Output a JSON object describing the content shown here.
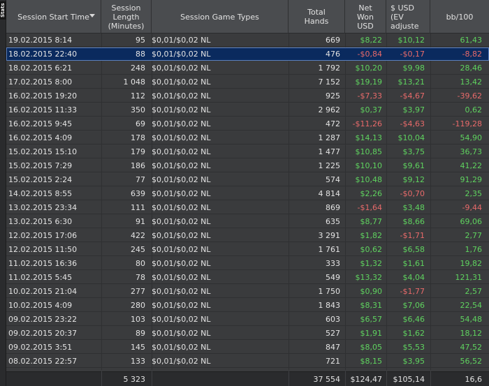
{
  "side_tab": {
    "label": "Stats"
  },
  "columns": {
    "start_time": "Session Start Time",
    "length": "Session Length (Minutes)",
    "game_types": "Session Game Types",
    "hands": "Total Hands",
    "net_won": "Net Won USD",
    "ev": "$ USD (EV adjuste",
    "bb100": "bb/100"
  },
  "colors": {
    "positive": "#5fd35f",
    "negative": "#e86a6a",
    "selected_row": "#0a2a5e"
  },
  "rows": [
    {
      "date": "19.02.2015 8:14",
      "len": "95",
      "type": "$0,01/$0,02 NL",
      "hands": "669",
      "net": "$8,22",
      "ev": "$10,12",
      "bb": "61,43",
      "net_s": "pos",
      "ev_s": "pos",
      "bb_s": "pos"
    },
    {
      "date": "18.02.2015 22:40",
      "len": "88",
      "type": "$0,01/$0,02 NL",
      "hands": "476",
      "net": "-$0,84",
      "ev": "-$0,17",
      "bb": "-8,82",
      "net_s": "neg",
      "ev_s": "neg",
      "bb_s": "neg",
      "selected": true
    },
    {
      "date": "18.02.2015 6:21",
      "len": "248",
      "type": "$0,01/$0,02 NL",
      "hands": "1 792",
      "net": "$10,20",
      "ev": "$9,98",
      "bb": "28,46",
      "net_s": "pos",
      "ev_s": "pos",
      "bb_s": "pos"
    },
    {
      "date": "17.02.2015 8:00",
      "len": "1 048",
      "type": "$0,01/$0,02 NL",
      "hands": "7 152",
      "net": "$19,19",
      "ev": "$13,21",
      "bb": "13,42",
      "net_s": "pos",
      "ev_s": "pos",
      "bb_s": "pos"
    },
    {
      "date": "16.02.2015 19:20",
      "len": "112",
      "type": "$0,01/$0,02 NL",
      "hands": "925",
      "net": "-$7,33",
      "ev": "-$4,67",
      "bb": "-39,62",
      "net_s": "neg",
      "ev_s": "neg",
      "bb_s": "neg"
    },
    {
      "date": "16.02.2015 11:33",
      "len": "350",
      "type": "$0,01/$0,02 NL",
      "hands": "2 962",
      "net": "$0,37",
      "ev": "$3,97",
      "bb": "0,62",
      "net_s": "pos",
      "ev_s": "pos",
      "bb_s": "pos"
    },
    {
      "date": "16.02.2015 9:45",
      "len": "69",
      "type": "$0,01/$0,02 NL",
      "hands": "472",
      "net": "-$11,26",
      "ev": "-$4,63",
      "bb": "-119,28",
      "net_s": "neg",
      "ev_s": "neg",
      "bb_s": "neg"
    },
    {
      "date": "16.02.2015 4:09",
      "len": "178",
      "type": "$0,01/$0,02 NL",
      "hands": "1 287",
      "net": "$14,13",
      "ev": "$10,04",
      "bb": "54,90",
      "net_s": "pos",
      "ev_s": "pos",
      "bb_s": "pos"
    },
    {
      "date": "15.02.2015 15:10",
      "len": "179",
      "type": "$0,01/$0,02 NL",
      "hands": "1 477",
      "net": "$10,85",
      "ev": "$3,75",
      "bb": "36,73",
      "net_s": "pos",
      "ev_s": "pos",
      "bb_s": "pos"
    },
    {
      "date": "15.02.2015 7:29",
      "len": "186",
      "type": "$0,01/$0,02 NL",
      "hands": "1 225",
      "net": "$10,10",
      "ev": "$9,61",
      "bb": "41,22",
      "net_s": "pos",
      "ev_s": "pos",
      "bb_s": "pos"
    },
    {
      "date": "15.02.2015 2:24",
      "len": "77",
      "type": "$0,01/$0,02 NL",
      "hands": "574",
      "net": "$10,48",
      "ev": "$9,12",
      "bb": "91,29",
      "net_s": "pos",
      "ev_s": "pos",
      "bb_s": "pos"
    },
    {
      "date": "14.02.2015 8:55",
      "len": "639",
      "type": "$0,01/$0,02 NL",
      "hands": "4 814",
      "net": "$2,26",
      "ev": "-$0,70",
      "bb": "2,35",
      "net_s": "pos",
      "ev_s": "neg",
      "bb_s": "pos"
    },
    {
      "date": "13.02.2015 23:34",
      "len": "111",
      "type": "$0,01/$0,02 NL",
      "hands": "869",
      "net": "-$1,64",
      "ev": "$3,48",
      "bb": "-9,44",
      "net_s": "neg",
      "ev_s": "pos",
      "bb_s": "neg"
    },
    {
      "date": "13.02.2015 6:30",
      "len": "91",
      "type": "$0,01/$0,02 NL",
      "hands": "635",
      "net": "$8,77",
      "ev": "$8,66",
      "bb": "69,06",
      "net_s": "pos",
      "ev_s": "pos",
      "bb_s": "pos"
    },
    {
      "date": "12.02.2015 17:06",
      "len": "422",
      "type": "$0,01/$0,02 NL",
      "hands": "3 291",
      "net": "$1,82",
      "ev": "-$1,71",
      "bb": "2,77",
      "net_s": "pos",
      "ev_s": "neg",
      "bb_s": "pos"
    },
    {
      "date": "12.02.2015 11:50",
      "len": "245",
      "type": "$0,01/$0,02 NL",
      "hands": "1 761",
      "net": "$0,62",
      "ev": "$6,58",
      "bb": "1,76",
      "net_s": "pos",
      "ev_s": "pos",
      "bb_s": "pos"
    },
    {
      "date": "11.02.2015 16:36",
      "len": "80",
      "type": "$0,01/$0,02 NL",
      "hands": "333",
      "net": "$1,32",
      "ev": "$1,61",
      "bb": "19,82",
      "net_s": "pos",
      "ev_s": "pos",
      "bb_s": "pos"
    },
    {
      "date": "11.02.2015 5:45",
      "len": "78",
      "type": "$0,01/$0,02 NL",
      "hands": "549",
      "net": "$13,32",
      "ev": "$4,04",
      "bb": "121,31",
      "net_s": "pos",
      "ev_s": "pos",
      "bb_s": "pos"
    },
    {
      "date": "10.02.2015 21:04",
      "len": "277",
      "type": "$0,01/$0,02 NL",
      "hands": "1 750",
      "net": "$0,90",
      "ev": "-$1,77",
      "bb": "2,57",
      "net_s": "pos",
      "ev_s": "neg",
      "bb_s": "pos"
    },
    {
      "date": "10.02.2015 4:09",
      "len": "280",
      "type": "$0,01/$0,02 NL",
      "hands": "1 843",
      "net": "$8,31",
      "ev": "$7,06",
      "bb": "22,54",
      "net_s": "pos",
      "ev_s": "pos",
      "bb_s": "pos"
    },
    {
      "date": "09.02.2015 23:22",
      "len": "103",
      "type": "$0,01/$0,02 NL",
      "hands": "603",
      "net": "$6,57",
      "ev": "$6,46",
      "bb": "54,48",
      "net_s": "pos",
      "ev_s": "pos",
      "bb_s": "pos"
    },
    {
      "date": "09.02.2015 20:37",
      "len": "89",
      "type": "$0,01/$0,02 NL",
      "hands": "527",
      "net": "$1,91",
      "ev": "$1,62",
      "bb": "18,12",
      "net_s": "pos",
      "ev_s": "pos",
      "bb_s": "pos"
    },
    {
      "date": "09.02.2015 3:51",
      "len": "145",
      "type": "$0,01/$0,02 NL",
      "hands": "847",
      "net": "$8,05",
      "ev": "$5,53",
      "bb": "47,52",
      "net_s": "pos",
      "ev_s": "pos",
      "bb_s": "pos"
    },
    {
      "date": "08.02.2015 22:57",
      "len": "133",
      "type": "$0,01/$0,02 NL",
      "hands": "721",
      "net": "$8,15",
      "ev": "$3,95",
      "bb": "56,52",
      "net_s": "pos",
      "ev_s": "pos",
      "bb_s": "pos"
    }
  ],
  "totals": {
    "len": "5 323",
    "hands": "37 554",
    "net": "$124,47",
    "ev": "$105,14",
    "bb": "16,6"
  }
}
